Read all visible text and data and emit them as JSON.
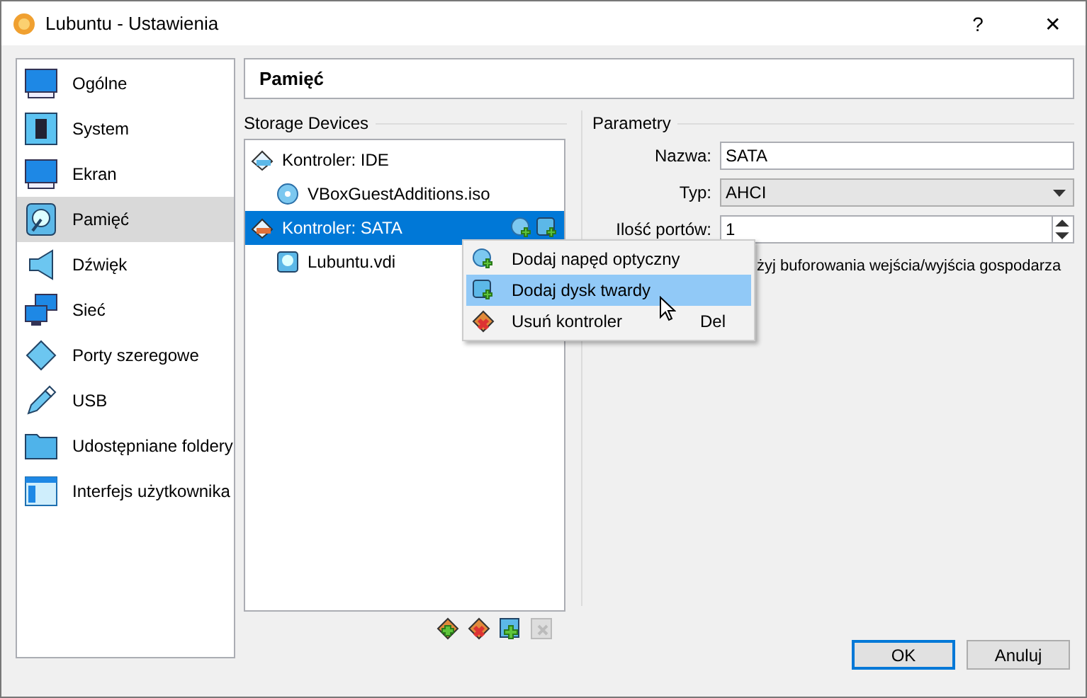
{
  "window": {
    "title": "Lubuntu - Ustawienia",
    "buttons": [
      "?",
      "✕"
    ]
  },
  "sidebar": {
    "items": [
      {
        "label": "Ogólne",
        "kind": "monitor",
        "selected": false
      },
      {
        "label": "System",
        "kind": "chip",
        "selected": false
      },
      {
        "label": "Ekran",
        "kind": "monitor",
        "selected": false
      },
      {
        "label": "Pamięć",
        "kind": "disk",
        "selected": true
      },
      {
        "label": "Dźwięk",
        "kind": "speaker",
        "selected": false
      },
      {
        "label": "Sieć",
        "kind": "network",
        "selected": false
      },
      {
        "label": "Porty szeregowe",
        "kind": "serial",
        "selected": false
      },
      {
        "label": "USB",
        "kind": "usb",
        "selected": false
      },
      {
        "label": "Udostępniane foldery",
        "kind": "folder",
        "selected": false
      },
      {
        "label": "Interfejs użytkownika",
        "kind": "ui",
        "selected": false
      }
    ]
  },
  "header": "Pamięć",
  "storage": {
    "title": "Storage Devices",
    "tree": [
      {
        "label": "Kontroler: IDE",
        "kind": "ide",
        "selected": false,
        "children": [
          {
            "label": "VBoxGuestAdditions.iso",
            "kind": "optical",
            "selected": false
          }
        ]
      },
      {
        "label": "Kontroler: SATA",
        "kind": "sata",
        "selected": true,
        "children": [
          {
            "label": "Lubuntu.vdi",
            "kind": "disk",
            "selected": false
          }
        ]
      }
    ]
  },
  "parameters": {
    "title": "Parametry",
    "fields": [
      {
        "kind": "text",
        "label": "Nazwa:",
        "value": "SATA"
      },
      {
        "kind": "select",
        "label": "Typ:",
        "value": "AHCI"
      },
      {
        "kind": "spin",
        "label": "Ilość portów:",
        "value": "1"
      }
    ],
    "checkbox_label": "żyj buforowania wejścia/wyjścia gospodarza"
  },
  "context_menu": {
    "items": [
      {
        "label": "Dodaj napęd optyczny",
        "kind": "optical",
        "selected": false
      },
      {
        "label": "Dodaj dysk twardy",
        "kind": "disk",
        "selected": true
      },
      {
        "label": "Usuń kontroler",
        "kind": "remove",
        "shortcut": "Del",
        "selected": false
      }
    ]
  },
  "buttons": [
    {
      "label": "OK",
      "default": true
    },
    {
      "label": "Anuluj",
      "default": false
    }
  ]
}
